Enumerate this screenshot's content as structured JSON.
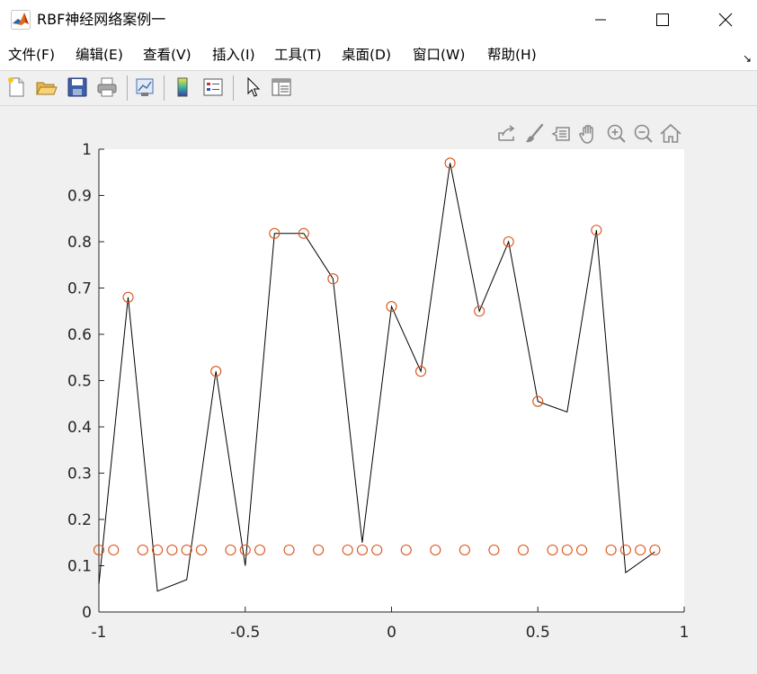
{
  "window": {
    "title": "RBF神经网络案例一",
    "icon": "matlab-icon",
    "controls": [
      "minimize-icon",
      "maximize-icon",
      "close-icon"
    ]
  },
  "menu": {
    "items": [
      "文件(F)",
      "编辑(E)",
      "查看(V)",
      "插入(I)",
      "工具(T)",
      "桌面(D)",
      "窗口(W)",
      "帮助(H)"
    ],
    "dock_arrow": "↘"
  },
  "toolbar": {
    "icons": [
      "new-figure-icon",
      "open-file-icon",
      "save-icon",
      "print-icon",
      "link-plot-icon",
      "colorbar-icon",
      "legend-icon",
      "pointer-icon",
      "property-inspector-icon"
    ]
  },
  "axes_toolbar": {
    "icons": [
      "export-icon",
      "brush-icon",
      "data-tips-icon",
      "pan-icon",
      "zoom-in-icon",
      "zoom-out-icon",
      "home-icon"
    ]
  },
  "colors": {
    "line": "#000000",
    "markers": "#d95319",
    "axes": "#262626",
    "axes_bg": "#ffffff",
    "figure_bg": "#f0f0f0"
  },
  "chart_data": {
    "type": "line",
    "title": "",
    "xlabel": "",
    "ylabel": "",
    "xlim": [
      -1,
      1
    ],
    "ylim": [
      0,
      1
    ],
    "xticks": [
      -1,
      -0.5,
      0,
      0.5,
      1
    ],
    "xtick_labels": [
      "-1",
      "-0.5",
      "0",
      "0.5",
      "1"
    ],
    "yticks": [
      0,
      0.1,
      0.2,
      0.3,
      0.4,
      0.5,
      0.6,
      0.7,
      0.8,
      0.9,
      1
    ],
    "ytick_labels": [
      "0",
      "0.1",
      "0.2",
      "0.3",
      "0.4",
      "0.5",
      "0.6",
      "0.7",
      "0.8",
      "0.9",
      "1"
    ],
    "grid": false,
    "legend": "none",
    "series": [
      {
        "style": "line",
        "x": [
          -1,
          -0.9,
          -0.8,
          -0.7,
          -0.6,
          -0.5,
          -0.4,
          -0.3,
          -0.2,
          -0.1,
          0,
          0.1,
          0.2,
          0.3,
          0.4,
          0.5,
          0.6,
          0.7,
          0.8,
          0.9
        ],
        "y": [
          0.06,
          0.68,
          0.045,
          0.07,
          0.52,
          0.1,
          0.818,
          0.818,
          0.72,
          0.15,
          0.66,
          0.52,
          0.97,
          0.65,
          0.8,
          0.455,
          0.432,
          0.825,
          0.085,
          0.13
        ]
      },
      {
        "style": "markers",
        "marker": "circle",
        "points": [
          [
            -1,
            0.134
          ],
          [
            -0.95,
            0.134
          ],
          [
            -0.9,
            0.68
          ],
          [
            -0.85,
            0.134
          ],
          [
            -0.8,
            0.134
          ],
          [
            -0.75,
            0.134
          ],
          [
            -0.7,
            0.134
          ],
          [
            -0.65,
            0.134
          ],
          [
            -0.6,
            0.52
          ],
          [
            -0.55,
            0.134
          ],
          [
            -0.5,
            0.134
          ],
          [
            -0.45,
            0.134
          ],
          [
            -0.4,
            0.818
          ],
          [
            -0.35,
            0.134
          ],
          [
            -0.3,
            0.818
          ],
          [
            -0.25,
            0.134
          ],
          [
            -0.2,
            0.72
          ],
          [
            -0.15,
            0.134
          ],
          [
            -0.1,
            0.134
          ],
          [
            -0.05,
            0.134
          ],
          [
            0,
            0.66
          ],
          [
            0.05,
            0.134
          ],
          [
            0.1,
            0.52
          ],
          [
            0.15,
            0.134
          ],
          [
            0.2,
            0.97
          ],
          [
            0.25,
            0.134
          ],
          [
            0.3,
            0.65
          ],
          [
            0.35,
            0.134
          ],
          [
            0.4,
            0.8
          ],
          [
            0.45,
            0.134
          ],
          [
            0.5,
            0.455
          ],
          [
            0.55,
            0.134
          ],
          [
            0.6,
            0.134
          ],
          [
            0.65,
            0.134
          ],
          [
            0.7,
            0.825
          ],
          [
            0.75,
            0.134
          ],
          [
            0.8,
            0.134
          ],
          [
            0.85,
            0.134
          ],
          [
            0.9,
            0.134
          ]
        ]
      }
    ]
  }
}
